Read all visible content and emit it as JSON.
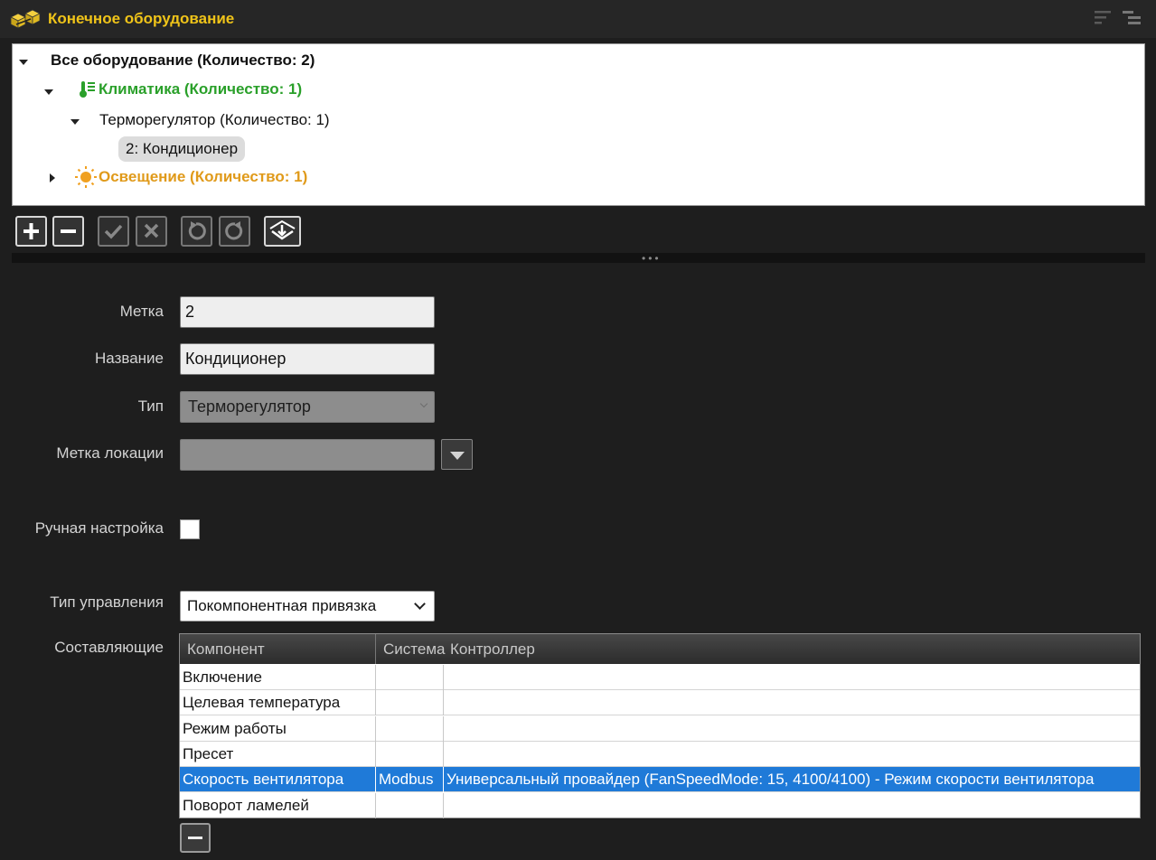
{
  "header": {
    "title": "Конечное оборудование",
    "icon": "equipment-cubes-icon",
    "buttons": [
      "sort-icon",
      "tree-collapse-icon"
    ]
  },
  "tree": {
    "root": "Все оборудование (Количество: 2)",
    "climate": "Климатика (Количество: 1)",
    "thermo_group": "Терморегулятор (Количество: 1)",
    "thermo_item": "2: Кондиционер",
    "lighting": "Освещение (Количество: 1)"
  },
  "toolbar": [
    "add-icon",
    "remove-icon",
    "apply-icon",
    "cancel-icon",
    "undo-icon",
    "redo-icon",
    "import-icon"
  ],
  "form": {
    "tag_label": "Метка",
    "tag_value": "2",
    "name_label": "Название",
    "name_value": "Кондиционер",
    "type_label": "Тип",
    "type_value": "Терморегулятор",
    "location_label": "Метка локации",
    "location_value": "",
    "manual_label": "Ручная настройка",
    "manual_checked": false,
    "control_label": "Тип управления",
    "control_value": "Покомпонентная привязка",
    "components_label": "Составляющие"
  },
  "table": {
    "headers": [
      "Компонент",
      "Система",
      "Контроллер"
    ],
    "rows": [
      [
        "Включение",
        "",
        ""
      ],
      [
        "Целевая температура",
        "",
        ""
      ],
      [
        "Режим работы",
        "",
        ""
      ],
      [
        "Пресет",
        "",
        ""
      ],
      [
        "Скорость вентилятора",
        "Modbus",
        "Универсальный провайдер (FanSpeedMode: 15, 4100/4100) - Режим скорости вентилятора"
      ],
      [
        "Поворот ламелей",
        "",
        ""
      ]
    ],
    "selected_row": 4
  },
  "colors": {
    "header_title": "#f0c419",
    "climate": "#2aa02a",
    "lighting": "#e09a1a",
    "selection": "#1f7ad8"
  }
}
